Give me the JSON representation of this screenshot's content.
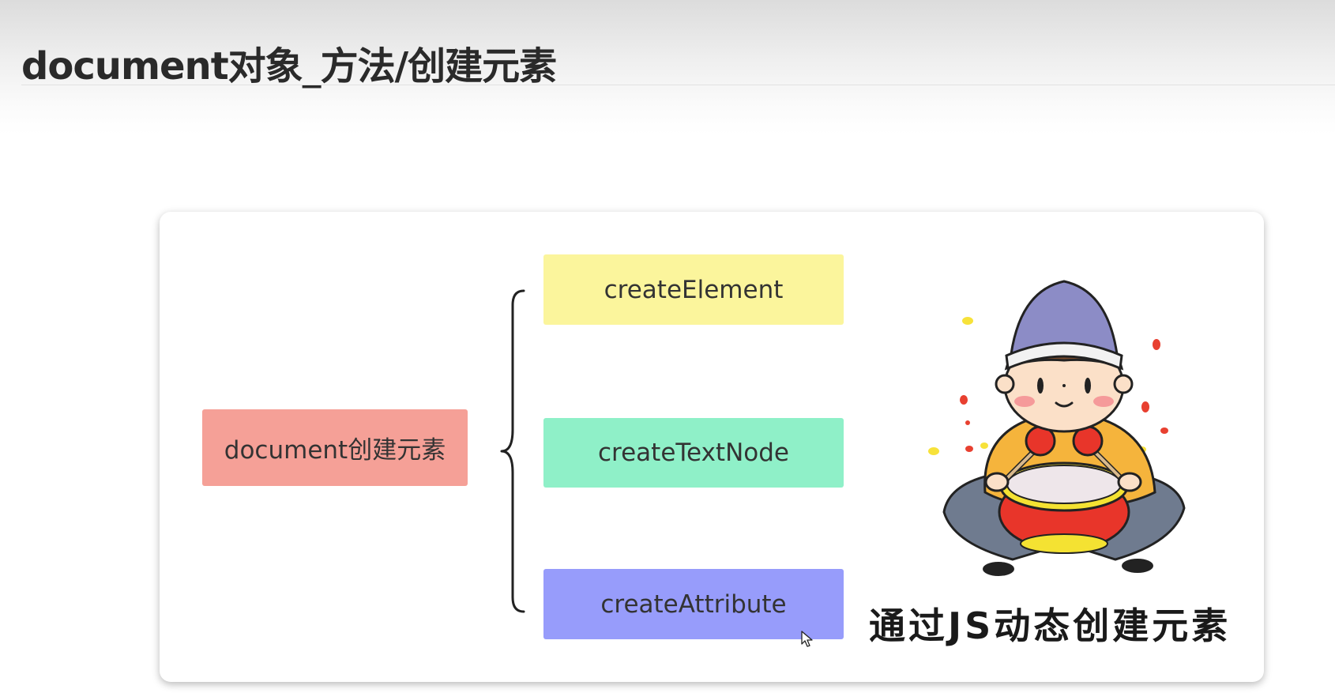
{
  "slide": {
    "title": "document对象_方法/创建元素"
  },
  "diagram": {
    "root": "document创建元素",
    "children": [
      "createElement",
      "createTextNode",
      "createAttribute"
    ],
    "colors": {
      "root": "#f5a097",
      "child_1": "#fbf59c",
      "child_2": "#8ff0c8",
      "child_3": "#979cfb"
    }
  },
  "illustration": {
    "icon": "drummer-boy-illustration",
    "caption": "通过JS动态创建元素"
  },
  "cursor": {
    "icon": "mouse-pointer-icon"
  }
}
